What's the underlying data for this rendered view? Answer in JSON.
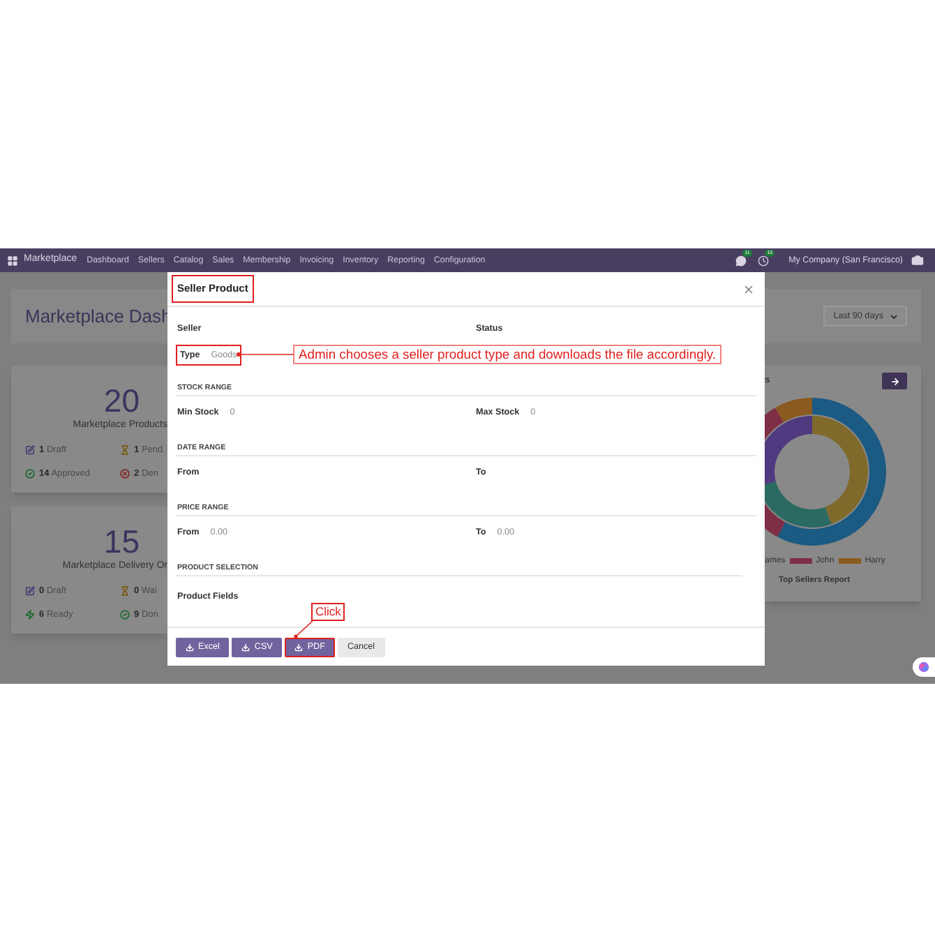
{
  "navbar": {
    "app": "Marketplace",
    "menu": [
      "Dashboard",
      "Sellers",
      "Catalog",
      "Sales",
      "Membership",
      "Invoicing",
      "Inventory",
      "Reporting",
      "Configuration"
    ],
    "messages_badge": "11",
    "activity_badge": "15",
    "company": "My Company (San Francisco)"
  },
  "dashboard": {
    "title": "Marketplace Dash",
    "period": "Last 90 days",
    "cards": [
      {
        "count": "20",
        "label": "Marketplace Products",
        "stats": [
          {
            "kind": "draft",
            "number": "1",
            "label": "Draft"
          },
          {
            "kind": "pending",
            "number": "1",
            "label": "Pend"
          },
          {
            "kind": "approved",
            "number": "14",
            "label": "Approved"
          },
          {
            "kind": "denied",
            "number": "2",
            "label": "Den"
          }
        ]
      },
      {
        "count": "15",
        "label": "Marketplace Delivery Or",
        "stats": [
          {
            "kind": "draft",
            "number": "0",
            "label": "Draft"
          },
          {
            "kind": "pending",
            "number": "0",
            "label": "Wai"
          },
          {
            "kind": "ready",
            "number": "6",
            "label": "Ready"
          },
          {
            "kind": "done",
            "number": "9",
            "label": "Don"
          }
        ]
      }
    ],
    "chart_card": {
      "title": "s",
      "legend": [
        {
          "label": "ames"
        },
        {
          "label": "John",
          "color": "#7e2f45"
        },
        {
          "label": "Harry",
          "color": "#8a5a1f"
        }
      ],
      "caption": "Top Sellers Report"
    }
  },
  "modal": {
    "title": {
      "text": "Seller Product",
      "highlighted": true
    },
    "top_fields": [
      {
        "label": "Seller"
      },
      {
        "label": "Status"
      }
    ],
    "type_field": {
      "label": "Type",
      "value": "Goods",
      "highlighted": true
    },
    "sections": [
      {
        "title": "STOCK RANGE",
        "fields": [
          {
            "label": "Min Stock",
            "value": "0"
          },
          {
            "label": "Max Stock",
            "value": "0"
          }
        ]
      },
      {
        "title": "DATE RANGE",
        "fields": [
          {
            "label": "From"
          },
          {
            "label": "To"
          }
        ]
      },
      {
        "title": "PRICE RANGE",
        "fields": [
          {
            "label": "From",
            "value": "0.00"
          },
          {
            "label": "To",
            "value": "0.00"
          }
        ]
      },
      {
        "title": "PRODUCT SELECTION",
        "fields": [
          {
            "label": "Product Fields"
          }
        ]
      }
    ],
    "buttons": [
      {
        "label": "Excel",
        "kind": "download",
        "highlighted": false
      },
      {
        "label": "CSV",
        "kind": "download",
        "highlighted": false
      },
      {
        "label": "PDF",
        "kind": "download",
        "highlighted": true
      },
      {
        "label": "Cancel",
        "kind": "secondary",
        "highlighted": false
      }
    ]
  },
  "annotations": [
    {
      "text": "Admin chooses a seller product type and downloads the file accordingly."
    },
    {
      "text": "Click"
    }
  ]
}
